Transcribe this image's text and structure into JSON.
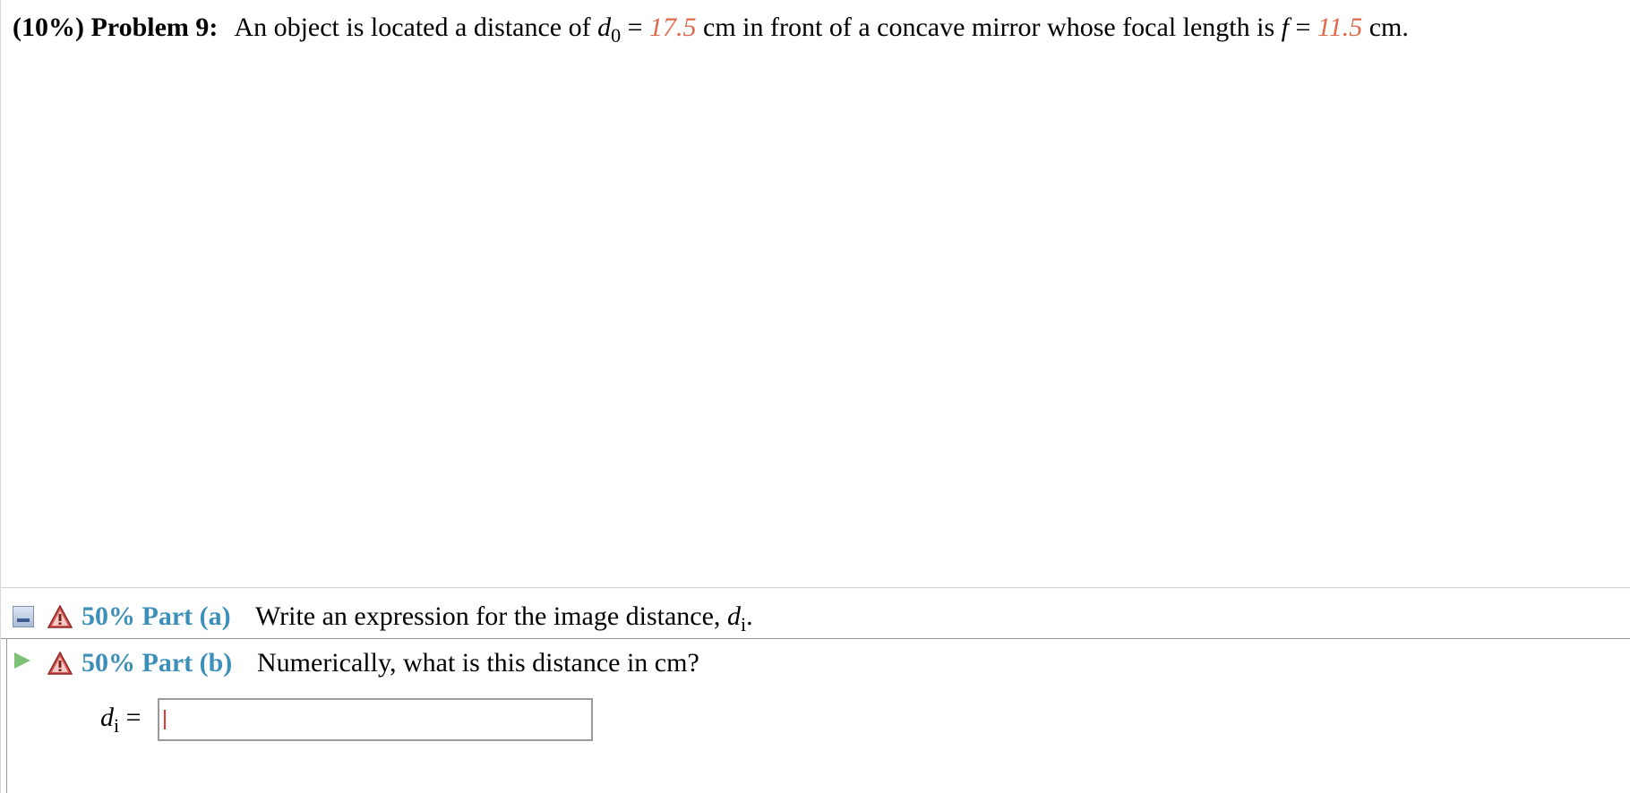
{
  "problem": {
    "weight": "(10%)",
    "title": "Problem 9:",
    "text_1": "An object is located a distance of ",
    "var_do": "d",
    "var_do_sub": "0",
    "equals": " = ",
    "do_value": "17.5",
    "text_2": " cm in front of a concave mirror whose focal length is ",
    "var_f": "f",
    "f_value": "11.5",
    "text_3": " cm."
  },
  "parts": [
    {
      "weight": "50%",
      "label": "Part (a)",
      "prompt": "Write an expression for the image distance, ",
      "var": "d",
      "var_sub": "i",
      "suffix": "."
    },
    {
      "weight": "50%",
      "label": "Part (b)",
      "prompt": "Numerically, what is this distance in cm?"
    }
  ],
  "answer": {
    "var": "d",
    "var_sub": "i",
    "equals": "=",
    "value": ""
  },
  "colors": {
    "given_value": "#e0684b",
    "part_label": "#3c8fb8",
    "warning": "#d9534f",
    "expand_arrow": "#7ec27a"
  },
  "icons": {
    "part_a_toggle": "collapse-icon",
    "part_b_toggle": "expand-arrow-icon",
    "status": "warning-icon"
  }
}
